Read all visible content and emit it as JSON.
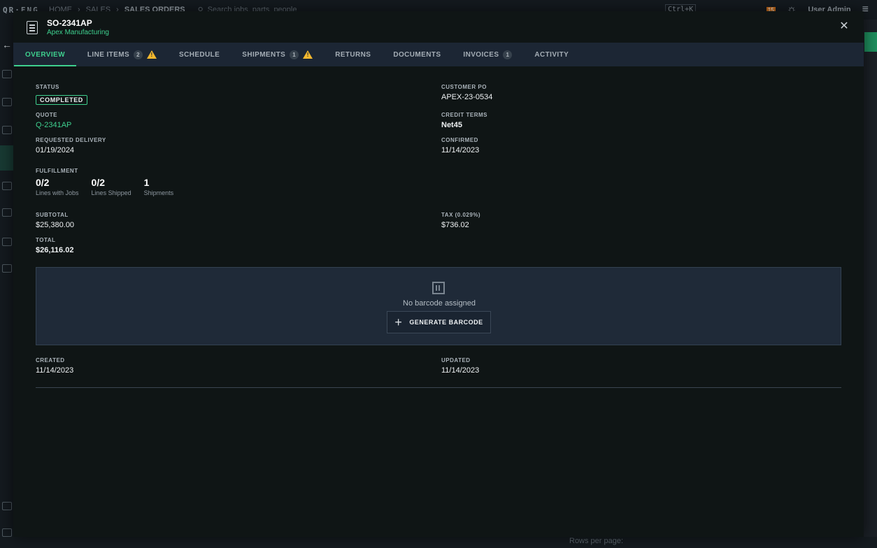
{
  "background": {
    "logo": "QR·ENG",
    "breadcrumbs": [
      "HOME",
      "SALES",
      "SALES ORDERS"
    ],
    "search_placeholder": "Search jobs, parts, people",
    "shortcut": "Ctrl+K",
    "notification_count": "15",
    "user": "User Admin",
    "rows_per_page": "Rows per page:"
  },
  "modal": {
    "title": "SO-2341AP",
    "subtitle": "Apex Manufacturing",
    "tabs": [
      {
        "label": "OVERVIEW",
        "count": null,
        "warn": false,
        "active": true
      },
      {
        "label": "LINE ITEMS",
        "count": "2",
        "warn": true
      },
      {
        "label": "SCHEDULE",
        "count": null,
        "warn": false
      },
      {
        "label": "SHIPMENTS",
        "count": "1",
        "warn": true
      },
      {
        "label": "RETURNS",
        "count": null,
        "warn": false
      },
      {
        "label": "DOCUMENTS",
        "count": null,
        "warn": false
      },
      {
        "label": "INVOICES",
        "count": "1",
        "warn": false
      },
      {
        "label": "ACTIVITY",
        "count": null,
        "warn": false
      }
    ]
  },
  "overview": {
    "status_label": "STATUS",
    "status": "COMPLETED",
    "customer_po_label": "CUSTOMER PO",
    "customer_po": "APEX-23-0534",
    "quote_label": "QUOTE",
    "quote": "Q-2341AP",
    "credit_terms_label": "CREDIT TERMS",
    "credit_terms": "Net45",
    "requested_delivery_label": "REQUESTED DELIVERY",
    "requested_delivery": "01/19/2024",
    "confirmed_label": "CONFIRMED",
    "confirmed": "11/14/2023",
    "fulfillment_label": "FULFILLMENT",
    "fulfillment": [
      {
        "value": "0/2",
        "caption": "Lines with Jobs"
      },
      {
        "value": "0/2",
        "caption": "Lines Shipped"
      },
      {
        "value": "1",
        "caption": "Shipments"
      }
    ],
    "subtotal_label": "SUBTOTAL",
    "subtotal": "$25,380.00",
    "tax_label": "TAX (0.029%)",
    "tax": "$736.02",
    "total_label": "TOTAL",
    "total": "$26,116.02",
    "no_barcode": "No barcode assigned",
    "generate_barcode": "GENERATE BARCODE",
    "created_label": "CREATED",
    "created": "11/14/2023",
    "updated_label": "UPDATED",
    "updated": "11/14/2023"
  }
}
